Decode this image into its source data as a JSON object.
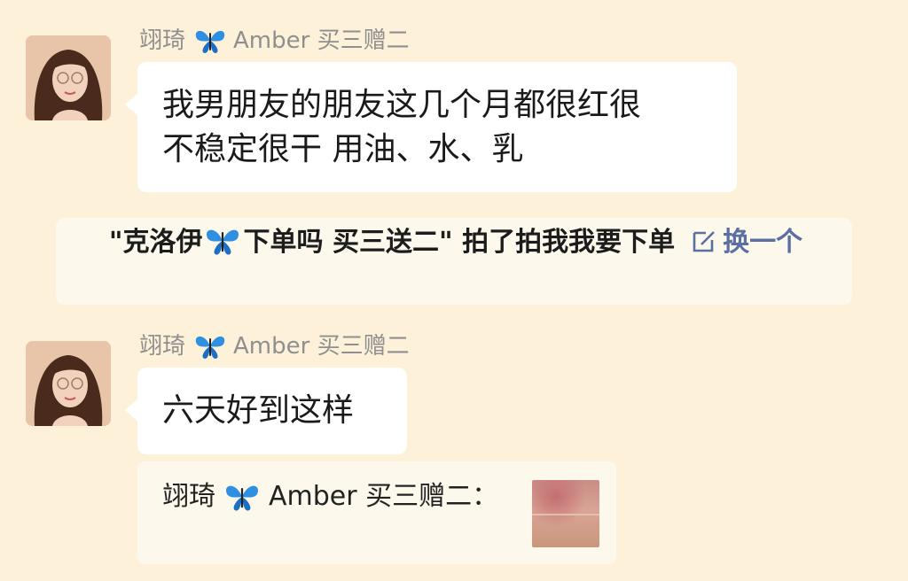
{
  "messages": [
    {
      "sender_name": "翊琦",
      "sender_suffix": "Amber 买三赠二",
      "avatar_icon": "avatar-woman-portrait",
      "text": "我男朋友的朋友这几个月都很红很\n不稳定很干 用油、水、乳"
    },
    {
      "sender_name": "翊琦",
      "sender_suffix": "Amber 买三赠二",
      "avatar_icon": "avatar-woman-portrait",
      "text": "六天好到这样"
    }
  ],
  "system_notice": {
    "prefix": "\"克洛伊",
    "middle": "下单吗 买三送二\" 拍了拍我我要下单",
    "change_label": "换一个",
    "change_icon": "edit-icon"
  },
  "quote": {
    "sender_name": "翊琦",
    "sender_suffix": "Amber 买三赠二：",
    "thumbnail_icon": "skin-photo-thumbnail"
  },
  "colors": {
    "background": "#fdf2d9",
    "bubble": "#ffffff",
    "butterfly": "#2f8fe0",
    "link_blue": "#5b6fa3",
    "sender_gray": "#8f8f8f"
  }
}
